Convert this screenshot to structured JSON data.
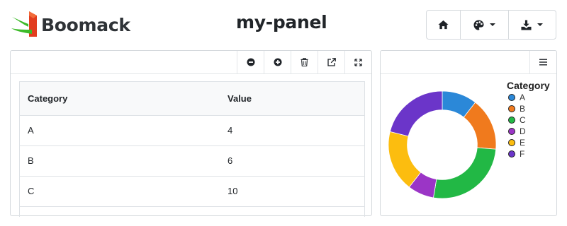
{
  "app": {
    "name": "Boomack"
  },
  "page": {
    "title": "my-panel"
  },
  "toolbar": {
    "buttons": [
      {
        "icon": "home-icon"
      },
      {
        "icon": "palette-icon",
        "dropdown": true
      },
      {
        "icon": "download-icon",
        "dropdown": true
      }
    ]
  },
  "table_panel": {
    "columns": [
      "Category",
      "Value"
    ],
    "rows": [
      [
        "A",
        "4"
      ],
      [
        "B",
        "6"
      ],
      [
        "C",
        "10"
      ]
    ]
  },
  "chart_data": {
    "type": "pie",
    "title": "",
    "legend_title": "Category",
    "legend_position": "right",
    "categories": [
      "A",
      "B",
      "C",
      "D",
      "E",
      "F"
    ],
    "values": [
      4,
      6,
      10,
      3,
      7,
      8
    ],
    "colors": [
      "#2b88d8",
      "#f07a1d",
      "#22b845",
      "#9b35c6",
      "#fcbd0f",
      "#6b35c9"
    ],
    "hole": 0.65
  }
}
